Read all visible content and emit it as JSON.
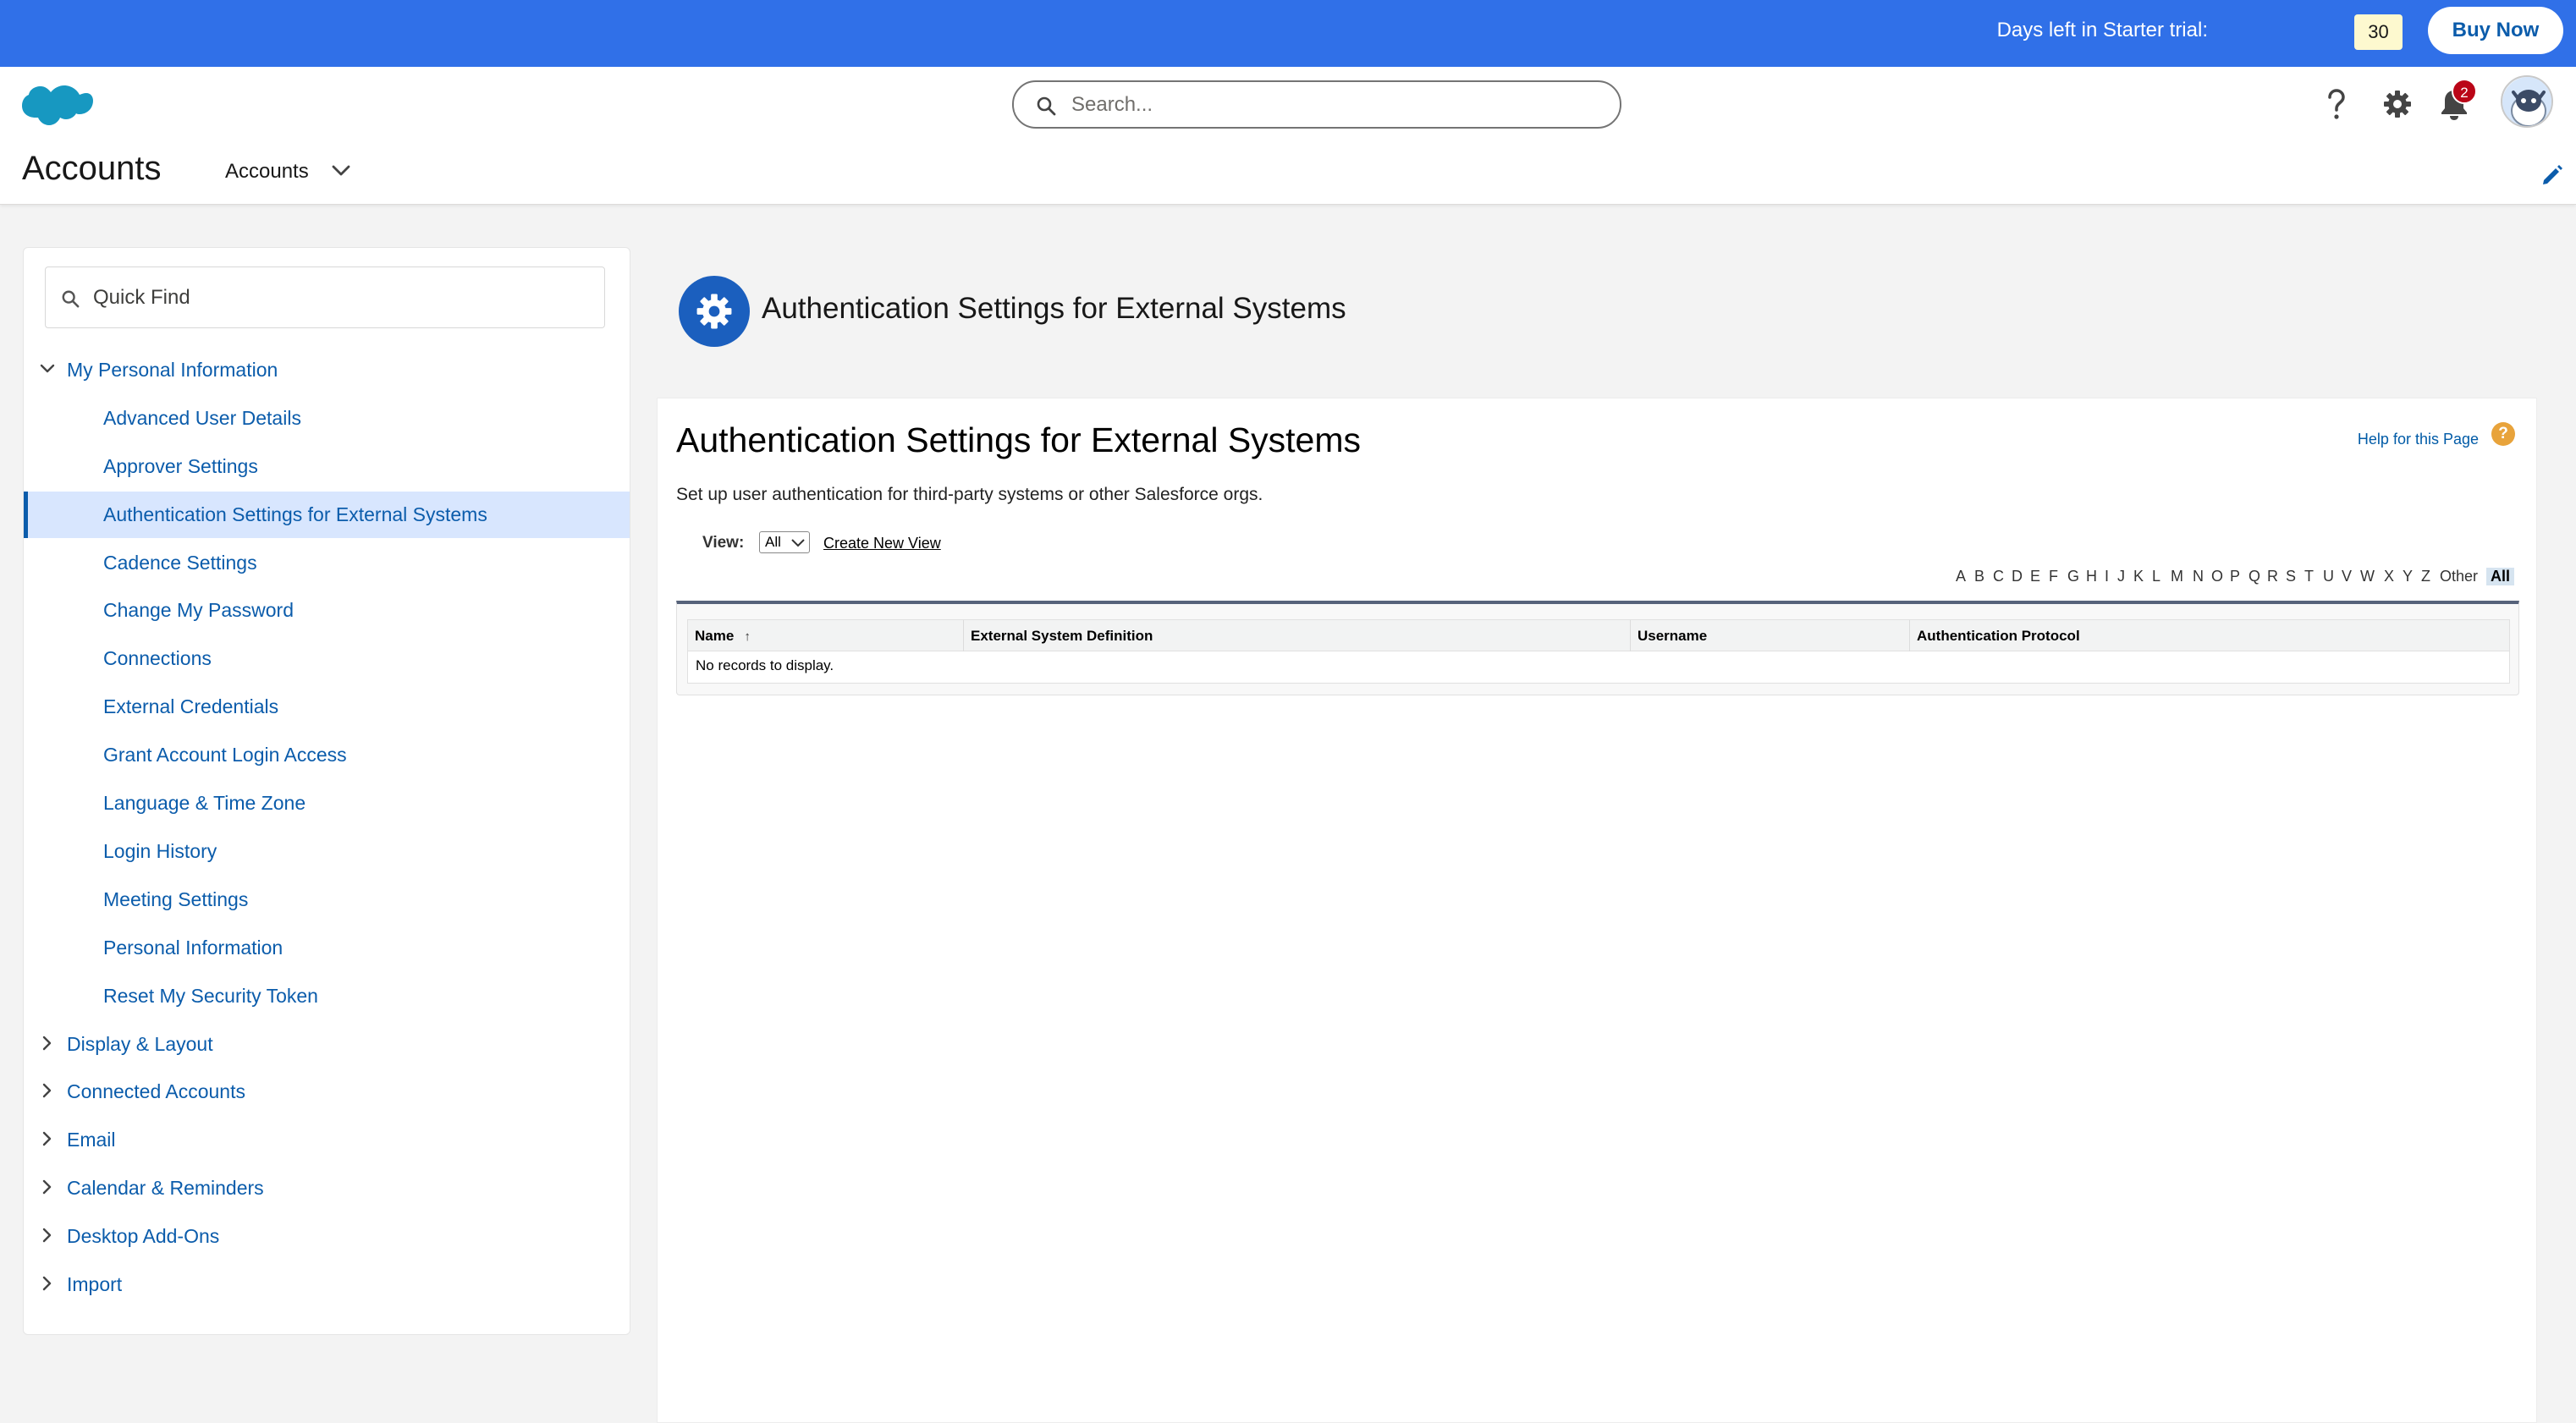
{
  "trial": {
    "label": "Days left in Starter trial:",
    "days": "30",
    "buy_label": "Buy Now"
  },
  "header": {
    "search_placeholder": "Search...",
    "notification_count": "2",
    "app_name": "Accounts",
    "nav_item": "Accounts"
  },
  "sidebar": {
    "quick_find_placeholder": "Quick Find",
    "section_main": "My Personal Information",
    "children": [
      "Advanced User Details",
      "Approver Settings",
      "Authentication Settings for External Systems",
      "Cadence Settings",
      "Change My Password",
      "Connections",
      "External Credentials",
      "Grant Account Login Access",
      "Language & Time Zone",
      "Login History",
      "Meeting Settings",
      "Personal Information",
      "Reset My Security Token"
    ],
    "selected_index": 2,
    "sections": [
      "Display & Layout",
      "Connected Accounts",
      "Email",
      "Calendar & Reminders",
      "Desktop Add-Ons",
      "Import"
    ]
  },
  "page": {
    "header_title": "Authentication Settings for External Systems",
    "title": "Authentication Settings for External Systems",
    "help_link": "Help for this Page",
    "help_badge": "?",
    "description": "Set up user authentication for third-party systems or other Salesforce orgs.",
    "view_label": "View:",
    "view_value": "All",
    "create_view": "Create New View",
    "alphabet": [
      "A",
      "B",
      "C",
      "D",
      "E",
      "F",
      "G",
      "H",
      "I",
      "J",
      "K",
      "L",
      "M",
      "N",
      "O",
      "P",
      "Q",
      "R",
      "S",
      "T",
      "U",
      "V",
      "W",
      "X",
      "Y",
      "Z",
      "Other",
      "All"
    ],
    "columns": [
      "Name",
      "External System Definition",
      "Username",
      "Authentication Protocol"
    ],
    "sort_arrow": "↑",
    "empty_text": "No records to display."
  },
  "colors": {
    "banner": "#3070e8",
    "link": "#0b5cab",
    "selected_bg": "#d8e6fe",
    "page_icon": "#1b5fbe",
    "badge": "#ba0517"
  }
}
